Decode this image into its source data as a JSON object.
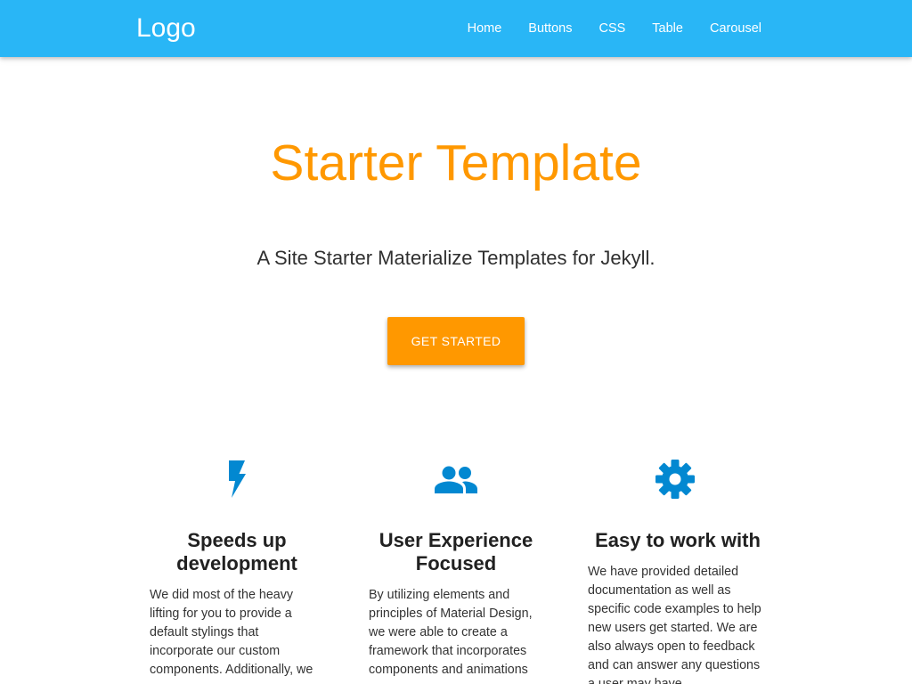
{
  "colors": {
    "navbar": "#29b6f6",
    "accent": "#ff9800",
    "icon": "#0288d1"
  },
  "navbar": {
    "brand": "Logo",
    "links": [
      {
        "label": "Home"
      },
      {
        "label": "Buttons"
      },
      {
        "label": "CSS"
      },
      {
        "label": "Table"
      },
      {
        "label": "Carousel"
      }
    ]
  },
  "hero": {
    "title": "Starter Template",
    "subtitle": "A Site Starter Materialize Templates for Jekyll.",
    "cta_label": "GET STARTED"
  },
  "features": [
    {
      "icon": "flash-icon",
      "title": "Speeds up development",
      "text": "We did most of the heavy lifting for you to provide a default stylings that incorporate our custom components. Additionally, we"
    },
    {
      "icon": "group-icon",
      "title": "User Experience Focused",
      "text": "By utilizing elements and principles of Material Design, we were able to create a framework that incorporates components and animations"
    },
    {
      "icon": "settings-icon",
      "title": "Easy to work with",
      "text": "We have provided detailed documentation as well as specific code examples to help new users get started. We are also always open to feedback and can answer any questions a user may have"
    }
  ]
}
